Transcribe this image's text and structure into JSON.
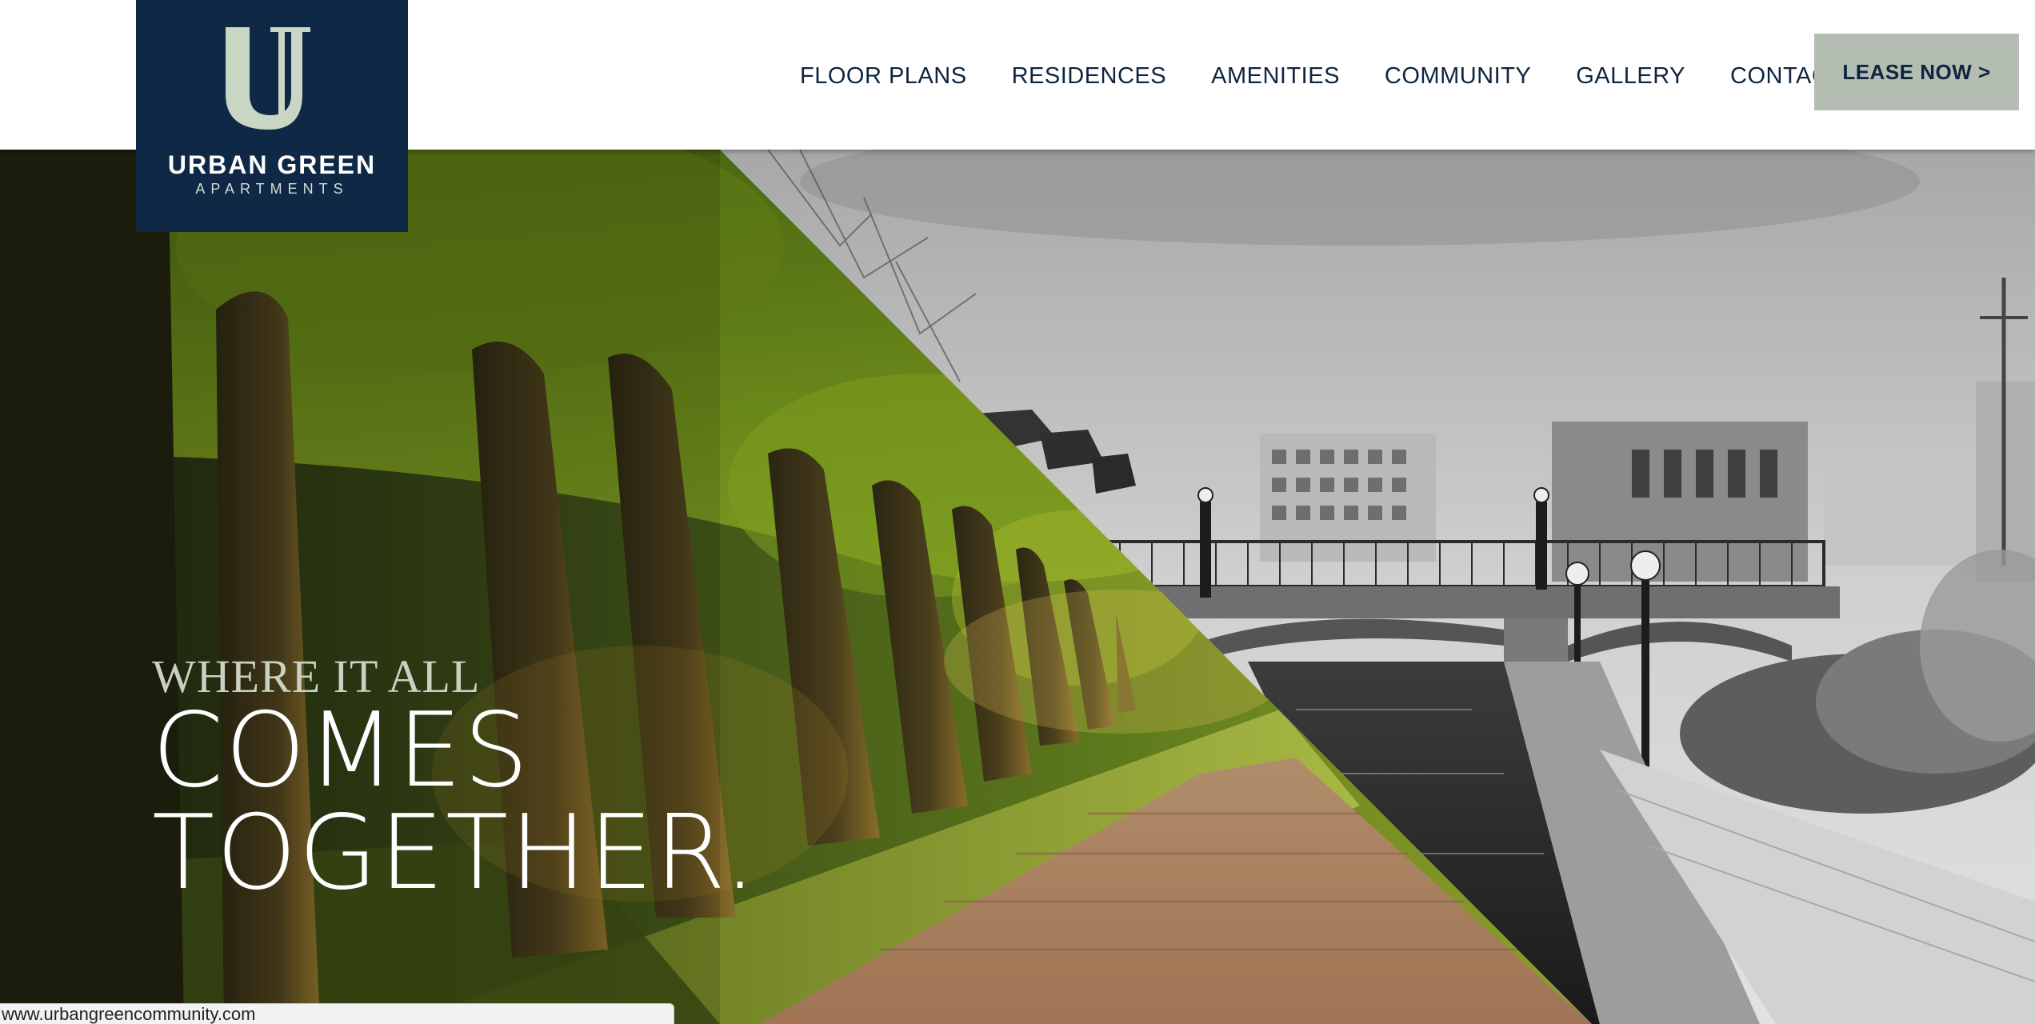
{
  "brand": {
    "logo_letter": "U",
    "name": "URBAN GREEN",
    "subtitle": "APARTMENTS",
    "navy": "#0e2846",
    "sage": "#b3bdb1",
    "mint": "#c9d6c4"
  },
  "nav": {
    "items": [
      {
        "label": "FLOOR PLANS"
      },
      {
        "label": "RESIDENCES"
      },
      {
        "label": "AMENITIES"
      },
      {
        "label": "COMMUNITY"
      },
      {
        "label": "GALLERY"
      },
      {
        "label": "CONTACT US"
      }
    ],
    "cta_label": "LEASE NOW >"
  },
  "hero": {
    "line1": "WHERE IT ALL",
    "line2": "COMES",
    "line3": "TOGETHER."
  },
  "status_bar": {
    "url": "www.urbangreencommunity.com"
  }
}
